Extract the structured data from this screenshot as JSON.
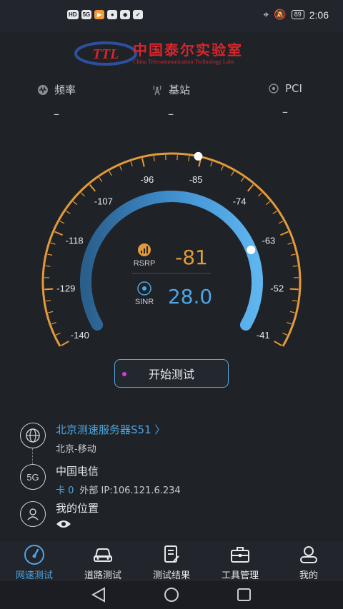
{
  "status_bar": {
    "left_icons": [
      "HD",
      "5G",
      "signal",
      "app",
      "chat",
      "app",
      "shield"
    ],
    "battery": "89",
    "time": "2:06"
  },
  "logo": {
    "mark": "TTL",
    "name_cn": "中国泰尔实验室",
    "name_en": "China Telecommunication Technology Labs"
  },
  "metrics": [
    {
      "icon": "waveform-icon",
      "label": "频率",
      "value": "–"
    },
    {
      "icon": "tower-icon",
      "label": "基站",
      "value": "–"
    },
    {
      "icon": "radio-icon",
      "label": "PCI",
      "value": "–"
    }
  ],
  "gauge": {
    "scale_labels": [
      "-140",
      "-129",
      "-118",
      "-107",
      "-96",
      "-85",
      "-74",
      "-63",
      "-52",
      "-41"
    ],
    "rsrp_label": "RSRP",
    "rsrp_value": "-81",
    "sinr_label": "SINR",
    "sinr_value": "28.0",
    "outer_color": "#e39a3a",
    "inner_color": "#4ea6e6"
  },
  "start_button": {
    "label": "开始测试"
  },
  "server": {
    "name": "北京测速服务器S51 〉",
    "location": "北京-移动"
  },
  "network": {
    "badge": "5G",
    "carrier": "中国电信",
    "card": "卡 0",
    "ip": "外部 IP:106.121.6.234"
  },
  "location": {
    "title": "我的位置"
  },
  "nav": [
    {
      "label": "网速测试",
      "active": true
    },
    {
      "label": "道路测试",
      "active": false
    },
    {
      "label": "测试结果",
      "active": false
    },
    {
      "label": "工具管理",
      "active": false
    },
    {
      "label": "我的",
      "active": false
    }
  ]
}
